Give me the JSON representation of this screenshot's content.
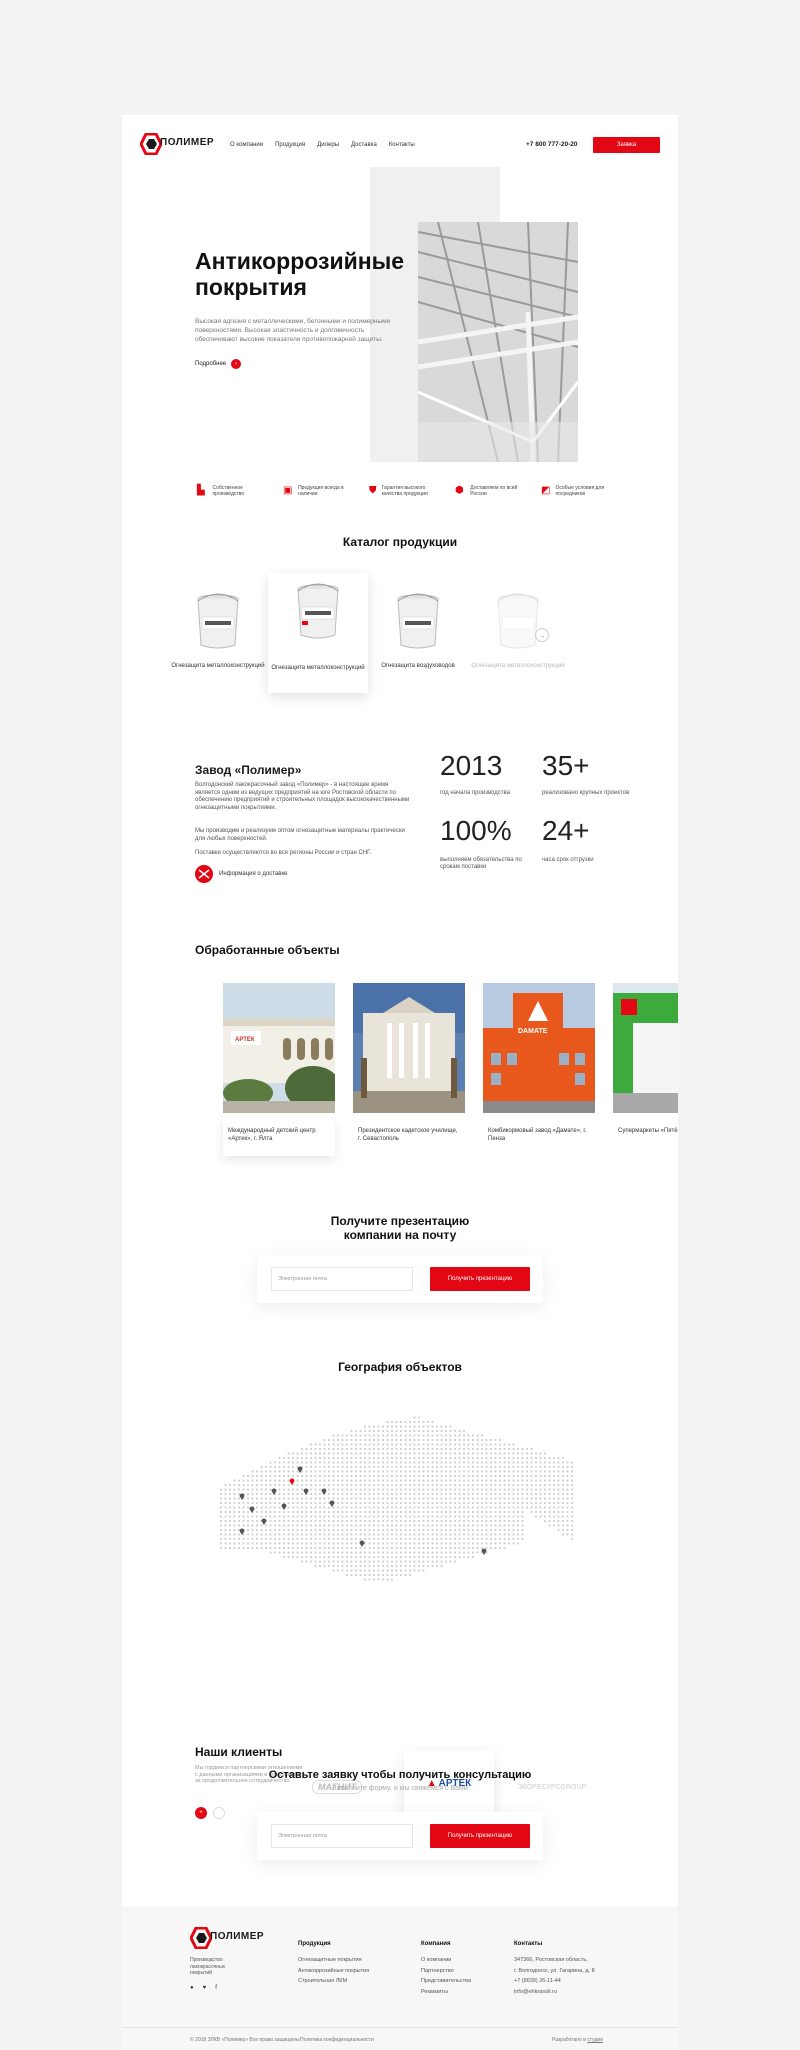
{
  "header": {
    "logo_text": "ПОЛИМЕР",
    "nav": [
      "О компании",
      "Продукция",
      "Дилеры",
      "Доставка",
      "Контакты"
    ],
    "phone": "+7 800 777-20-20",
    "cta": "Заявка"
  },
  "hero": {
    "title_line1": "Антикоррозийные",
    "title_line2": "покрытия",
    "description": "Высокая адгезия с металлическими, бетонными и полимерными поверхностями. Высокая эластичность и долговечность обеспечивают высокие показатели противопожарной защиты.",
    "more": "Подробнее"
  },
  "features": [
    {
      "icon": "factory-icon",
      "text": "Собственное производство"
    },
    {
      "icon": "truck-icon",
      "text": "Продукция всегда в наличии"
    },
    {
      "icon": "shield-icon",
      "text": "Гарантия высокого качества продукции"
    },
    {
      "icon": "delivery-icon",
      "text": "Доставляем по всей России"
    },
    {
      "icon": "handshake-icon",
      "text": "Особые условия для посредников"
    }
  ],
  "catalog": {
    "title": "Каталог продукции",
    "items": [
      "Огнезащита металлоконструкций",
      "Огнезащита металлоконструкций",
      "Огнезащита воздуховодов",
      "Огнезащита металлоконструкций"
    ]
  },
  "factory": {
    "title": "Завод «Полимер»",
    "p1": "Волгодонский лакокрасочный завод «Полимер» - в настоящее время является одним из ведущих предприятий на юге Ростовской области по обеспечению предприятий и строительных площадок высококачественными огнезащитными покрытиями.",
    "p2": "Мы производим и реализуем оптом огнезащитные материалы практически для любых поверхностей.",
    "p3": "Поставки осуществляются во все регионы России и стран СНГ.",
    "delivery_link": "Информация о доставке",
    "stats": [
      {
        "value": "2013",
        "label": "год начала производства"
      },
      {
        "value": "35+",
        "label": "реализовано крупных проектов"
      },
      {
        "value": "100%",
        "label": "выполняем обязательства по срокам поставки"
      },
      {
        "value": "24+",
        "label": "часа срок отгрузки"
      }
    ]
  },
  "objects": {
    "title": "Обработанные объекты",
    "items": [
      {
        "caption": "Международный детский центр «Артек», г. Ялта"
      },
      {
        "caption": "Президентское кадетское училище, г. Севастополь"
      },
      {
        "caption": "Комбикормовый завод «Дамате», г. Пенза"
      },
      {
        "caption": "Супермаркеты «Пятёрочка»"
      }
    ],
    "artek_sign": "АРТЕК",
    "damate_sign": "DAMATE"
  },
  "presentation": {
    "title_line1": "Получите презентацию",
    "title_line2": "компании на почту",
    "placeholder": "Электронная почта",
    "button": "Получить презентацию"
  },
  "geography": {
    "title": "География объектов"
  },
  "clients": {
    "title": "Наши клиенты",
    "text": "Мы гордимся партнерскими отношениями с данными организациями и благодарим за продолжительное сотрудничество",
    "logos": [
      "МАГНИТ",
      "АРТЕК",
      "ЭКОРЕСУРСGROUP"
    ]
  },
  "consult": {
    "title": "Оставьте заявку чтобы получить консультацию",
    "subtitle": "Заполните форму, и мы свяжемся с Вами",
    "placeholder": "Электронная почта",
    "button": "Получить презентацию"
  },
  "footer": {
    "tagline": "Производство лакокрасочных покрытий",
    "col_products": "Продукция",
    "products": [
      "Огнезащитные покрытия",
      "Антикоррозийные покрытия",
      "Строительная ЛКМ"
    ],
    "col_company": "Компания",
    "company": [
      "О компании",
      "Партнерство",
      "Представительства",
      "Реквизиты"
    ],
    "col_contacts": "Контакты",
    "contacts": [
      "347366, Ростовская область,",
      "г. Волгодонск, ул. Гагарина, д. 8",
      "+7 (8639) 26-11-44",
      "info@ehkrasoil.ru"
    ],
    "copyright": "© 2018 ЗЛКВ «Полимер» Все права защищены",
    "privacy": "Политика конфиденциальности",
    "dev_label": "Разработано в",
    "dev_link": "студии"
  },
  "colors": {
    "accent": "#e30613",
    "bg": "#f3f3f3"
  }
}
